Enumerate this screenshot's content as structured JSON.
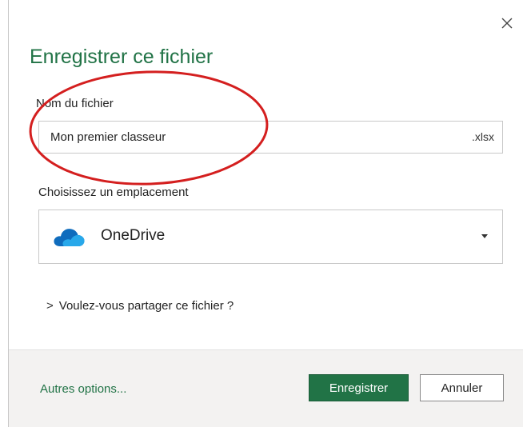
{
  "dialog": {
    "title": "Enregistrer ce fichier",
    "close_icon": "close-icon"
  },
  "file_name": {
    "label": "Nom du fichier",
    "value": "Mon premier classeur",
    "extension": ".xlsx"
  },
  "location": {
    "label": "Choisissez un emplacement",
    "selected": "OneDrive",
    "icon": "onedrive-cloud-icon",
    "dropdown_icon": "chevron-down-icon"
  },
  "share": {
    "label": "Voulez-vous partager ce fichier ?",
    "chevron": ">"
  },
  "footer": {
    "more_options": "Autres options...",
    "save_label": "Enregistrer",
    "cancel_label": "Annuler"
  },
  "colors": {
    "accent": "#217346",
    "onedrive_blue": "#0f6cbd",
    "annotation_red": "#d41f1f"
  }
}
